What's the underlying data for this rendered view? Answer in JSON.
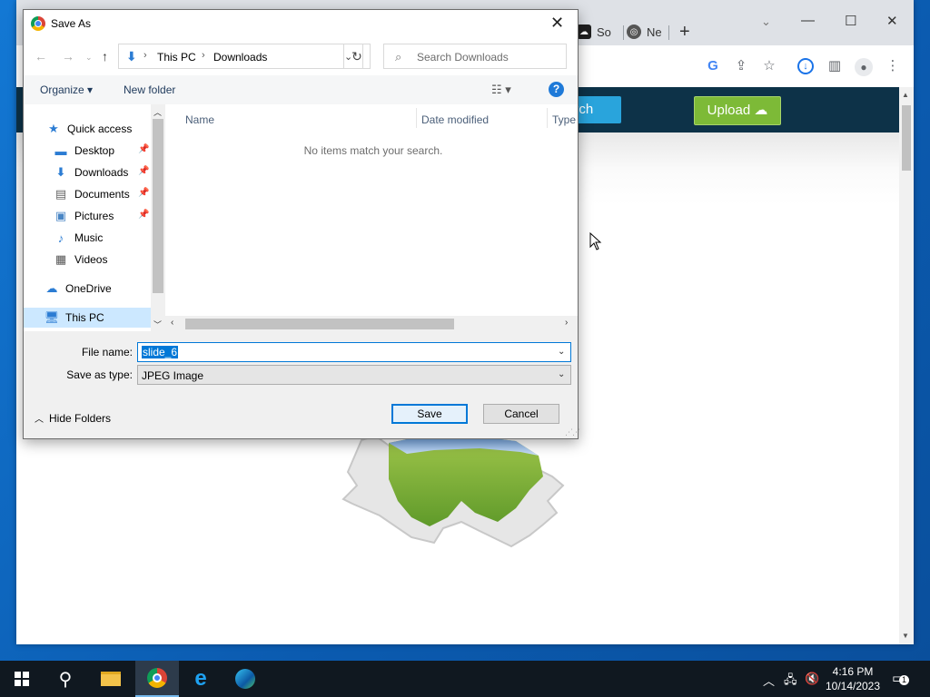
{
  "browser": {
    "tabs": [
      {
        "label": "So",
        "icon": "cloud-upload-icon"
      },
      {
        "label": "Ne",
        "icon": "chrome-icon"
      }
    ],
    "new_tab": "+",
    "site": {
      "search_label": "arch",
      "upload_label": "Upload"
    }
  },
  "dialog": {
    "title": "Save As",
    "close": "✕",
    "address": {
      "crumbs": [
        "This PC",
        "Downloads"
      ],
      "search_placeholder": "Search Downloads"
    },
    "commands": {
      "organize": "Organize ▾",
      "new_folder": "New folder"
    },
    "nav": [
      {
        "label": "Quick access",
        "icon": "star-icon",
        "pinned": false
      },
      {
        "label": "Desktop",
        "icon": "desktop-icon",
        "pinned": true
      },
      {
        "label": "Downloads",
        "icon": "download-icon",
        "pinned": true
      },
      {
        "label": "Documents",
        "icon": "documents-icon",
        "pinned": true
      },
      {
        "label": "Pictures",
        "icon": "pictures-icon",
        "pinned": true
      },
      {
        "label": "Music",
        "icon": "music-icon",
        "pinned": false
      },
      {
        "label": "Videos",
        "icon": "videos-icon",
        "pinned": false
      },
      {
        "label": "OneDrive",
        "icon": "cloud-icon",
        "pinned": false
      },
      {
        "label": "This PC",
        "icon": "computer-icon",
        "pinned": false,
        "selected": true
      }
    ],
    "columns": [
      "Name",
      "Date modified",
      "Type"
    ],
    "empty_message": "No items match your search.",
    "file_name_label": "File name:",
    "file_name_value": "slide_6",
    "save_type_label": "Save as type:",
    "save_type_value": "JPEG Image",
    "hide_folders": "Hide Folders",
    "save_button": "Save",
    "cancel_button": "Cancel"
  },
  "taskbar": {
    "time": "4:16 PM",
    "date": "10/14/2023",
    "notification_count": "1"
  },
  "colors": {
    "accent": "#0078d7",
    "site_nav": "#0d3248",
    "search_button": "#29a4dc",
    "upload_button": "#7dba37"
  }
}
